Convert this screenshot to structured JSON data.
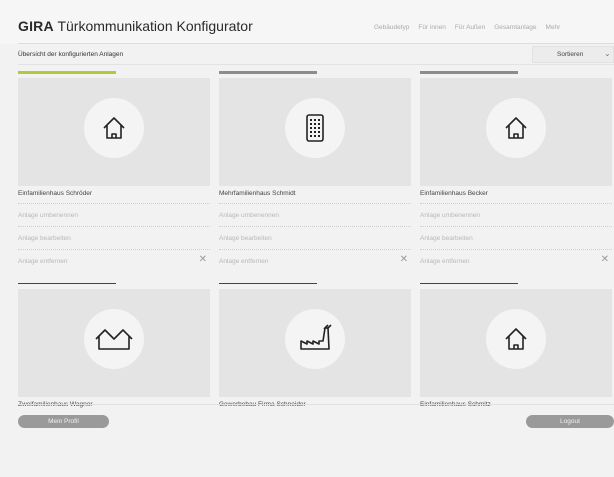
{
  "header": {
    "brand_bold": "GIRA",
    "brand_rest": " Türkommunikation Konfigurator",
    "nav": [
      "Gebäudetyp",
      "Für innen",
      "Für Außen",
      "Gesamtanlage",
      "Mehr"
    ]
  },
  "subbar": {
    "title": "Übersicht der konfigurierten Anlagen",
    "sort_label": "Sortieren",
    "sort_icon": "chevron-down-icon"
  },
  "actions": {
    "rename": "Anlage umbenennen",
    "edit": "Anlage bearbeiten",
    "remove": "Anlage entfernen",
    "remove_icon": "close-icon"
  },
  "colors": {
    "active_bar": "#b4c83c",
    "inactive_bar": "#8c8c8c",
    "button": "#9a9a9a"
  },
  "cards": [
    {
      "name": "Einfamilienhaus Schröder",
      "icon": "house-icon"
    },
    {
      "name": "Mehrfamilienhaus Schmidt",
      "icon": "apartment-building-icon"
    },
    {
      "name": "Einfamilienhaus Becker",
      "icon": "house-icon"
    },
    {
      "name": "Zweifamilienhaus Wagner",
      "icon": "two-family-house-icon"
    },
    {
      "name": "Gewerbebau Firma Schneider",
      "icon": "factory-icon"
    },
    {
      "name": "Einfamilienhaus Schmitz",
      "icon": "house-icon"
    }
  ],
  "footer": {
    "profile_button": "Mein Profil",
    "logout_button": "Logout"
  }
}
